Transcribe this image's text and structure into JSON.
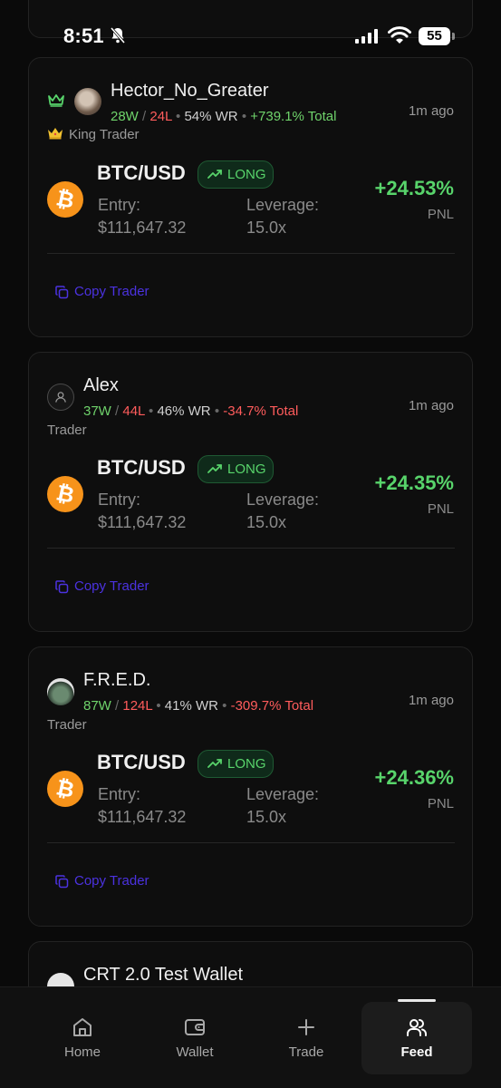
{
  "status_bar": {
    "time": "8:51",
    "battery": "55"
  },
  "cards": [
    {
      "name": "Hector_No_Greater",
      "wins": "28W",
      "losses": "24L",
      "win_rate": "54% WR",
      "total": "+739.1% Total",
      "time_ago": "1m ago",
      "rank": "King Trader",
      "pair": "BTC/USD",
      "direction": "LONG",
      "entry_label": "Entry:",
      "entry_value": "$111,647.32",
      "leverage_label": "Leverage:",
      "leverage_value": "15.0x",
      "pnl": "+24.53%",
      "pnl_label": "PNL",
      "copy_label": "Copy Trader"
    },
    {
      "name": "Alex",
      "wins": "37W",
      "losses": "44L",
      "win_rate": "46% WR",
      "total": "-34.7% Total",
      "time_ago": "1m ago",
      "rank": "Trader",
      "pair": "BTC/USD",
      "direction": "LONG",
      "entry_label": "Entry:",
      "entry_value": "$111,647.32",
      "leverage_label": "Leverage:",
      "leverage_value": "15.0x",
      "pnl": "+24.35%",
      "pnl_label": "PNL",
      "copy_label": "Copy Trader"
    },
    {
      "name": "F.R.E.D.",
      "wins": "87W",
      "losses": "124L",
      "win_rate": "41% WR",
      "total": "-309.7% Total",
      "time_ago": "1m ago",
      "rank": "Trader",
      "pair": "BTC/USD",
      "direction": "LONG",
      "entry_label": "Entry:",
      "entry_value": "$111,647.32",
      "leverage_label": "Leverage:",
      "leverage_value": "15.0x",
      "pnl": "+24.36%",
      "pnl_label": "PNL",
      "copy_label": "Copy Trader"
    },
    {
      "name": "CRT 2.0 Test Wallet"
    }
  ],
  "nav": {
    "home": "Home",
    "wallet": "Wallet",
    "trade": "Trade",
    "feed": "Feed",
    "active": "Feed"
  },
  "colors": {
    "positive": "#58d46b",
    "negative": "#ff5c5c",
    "link": "#4b32e0",
    "bitcoin": "#f7931a"
  }
}
